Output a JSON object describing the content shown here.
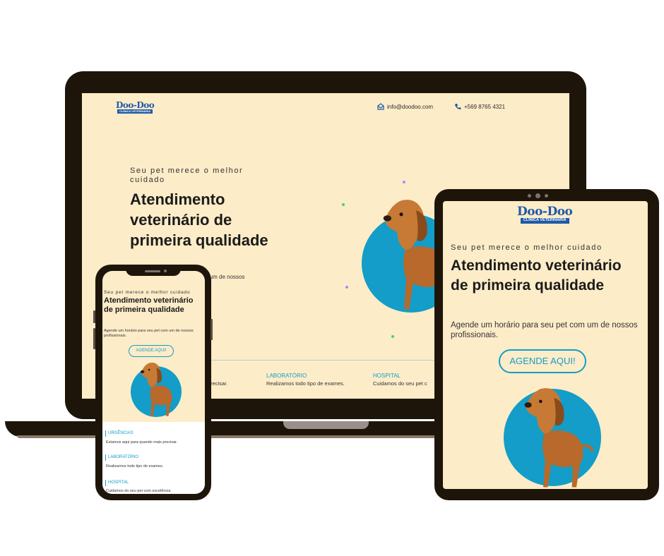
{
  "brand": {
    "name": "Doo-Doo",
    "subtitle": "CLÍNICA VETERINÁRIA"
  },
  "contact": {
    "email": "info@doodoo.com",
    "phone": "+569 8765 4321"
  },
  "hero": {
    "kicker": "Seu pet merece o melhor cuidado",
    "title": "Atendimento veterinário de primeira qualidade",
    "description": "Agende um horário para seu pet com um de nossos profissionais.",
    "laptop_desc_visible": "pet com um de nossos",
    "cta": "AGENDE AQUI!"
  },
  "services": [
    {
      "title": "URGÊNCIAS",
      "description": "Estamos aqui para quando mais precisar."
    },
    {
      "title": "LABORATÓRIO",
      "description": "Realizamos todo tipo de exames."
    },
    {
      "title": "HOSPITAL",
      "description": "Cuidamos do seu pet com excelência"
    }
  ],
  "laptop_visible": {
    "service0_desc_tail": "mais precisar.",
    "service2_desc_partial": "Cuidamos do seu pet c"
  },
  "colors": {
    "page_bg": "#fdecc8",
    "accent": "#139dc8",
    "brand": "#1f5aa6",
    "device_frame": "#1e150a"
  },
  "icons": {
    "email": "mail-icon",
    "phone": "phone-icon"
  }
}
